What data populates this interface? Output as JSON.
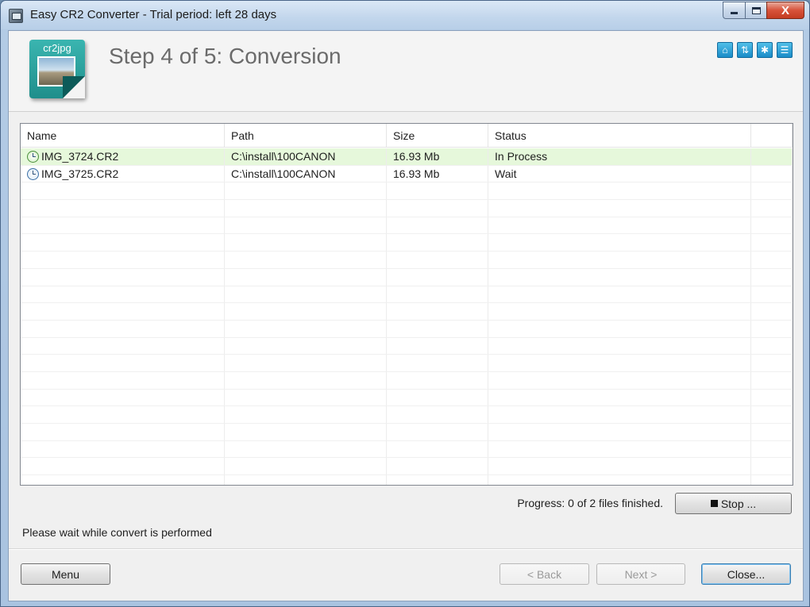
{
  "window": {
    "title": "Easy CR2 Converter - Trial period: left 28 days",
    "controls": {
      "minimize": "minimize-button",
      "maximize": "maximize-button",
      "close_label": "X"
    }
  },
  "header": {
    "logo_label": "cr2jpg",
    "title": "Step 4 of 5: Conversion",
    "icons": [
      "home-icon",
      "network-icon",
      "settings-icon",
      "info-icon"
    ]
  },
  "list": {
    "columns": [
      "Name",
      "Path",
      "Size",
      "Status"
    ],
    "rows": [
      {
        "name": "IMG_3724.CR2",
        "path": "C:\\install\\100CANON",
        "size": "16.93 Mb",
        "status": "In Process"
      },
      {
        "name": "IMG_3725.CR2",
        "path": "C:\\install\\100CANON",
        "size": "16.93 Mb",
        "status": "Wait"
      }
    ]
  },
  "progress": {
    "text": "Progress: 0 of 2 files finished.",
    "stop_label": "Stop ..."
  },
  "status_message": "Please wait while convert is performed",
  "footer": {
    "menu_label": "Menu",
    "back_label": "< Back",
    "next_label": "Next >",
    "close_label": "Close..."
  },
  "colors": {
    "selected_row": "#e6f8db",
    "accent_icon": "#1a8cc8",
    "logo": "#2aa39f"
  }
}
